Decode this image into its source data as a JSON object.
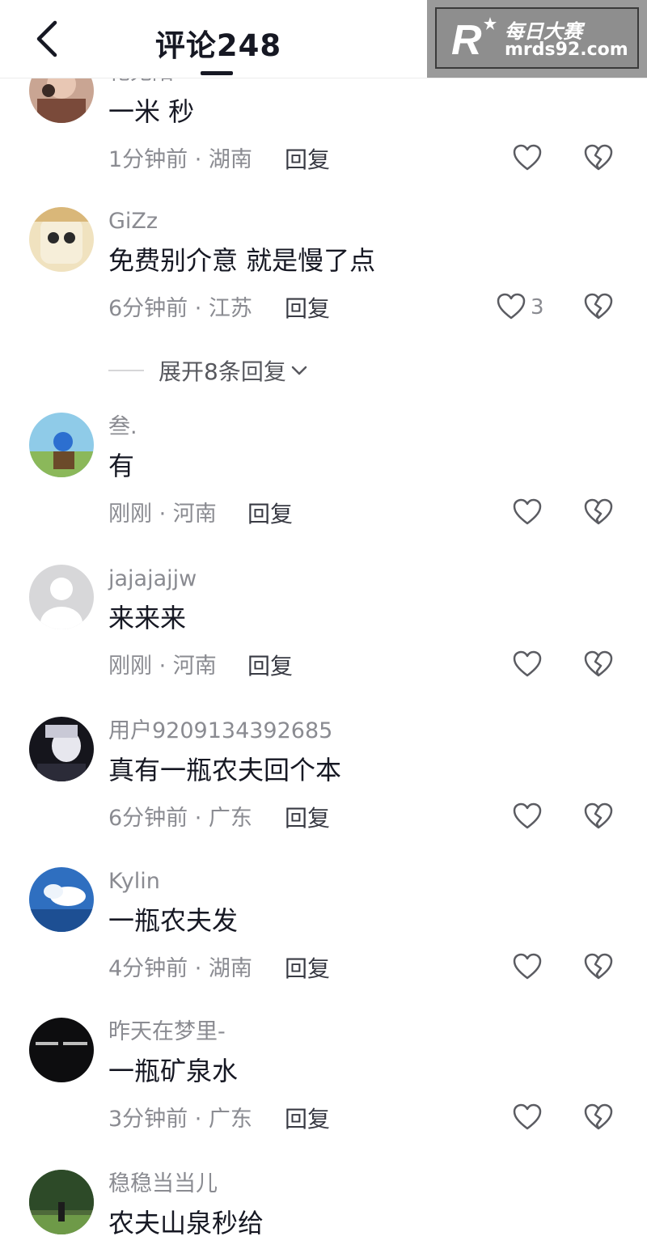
{
  "header": {
    "title": "评论248"
  },
  "watermark": {
    "brand_text": "每日大赛",
    "domain_text": "mrds92.com",
    "logo_letter": "R"
  },
  "comments": [
    {
      "username": "花无陌",
      "text": "一米 秒",
      "meta": "1分钟前 · 湖南",
      "reply_label": "回复",
      "like_count": ""
    },
    {
      "username": "GiZz",
      "text": "免费别介意 就是慢了点",
      "meta": "6分钟前 · 江苏",
      "reply_label": "回复",
      "like_count": "3",
      "expand_label": "展开8条回复"
    },
    {
      "username": "叁.",
      "text": "有",
      "meta": "刚刚 · 河南",
      "reply_label": "回复",
      "like_count": ""
    },
    {
      "username": "jajajajjw",
      "text": "来来来",
      "meta": "刚刚 · 河南",
      "reply_label": "回复",
      "like_count": ""
    },
    {
      "username": "用户9209134392685",
      "text": "真有一瓶农夫回个本",
      "meta": "6分钟前 · 广东",
      "reply_label": "回复",
      "like_count": ""
    },
    {
      "username": "Kylin",
      "text": "一瓶农夫发",
      "meta": "4分钟前 · 湖南",
      "reply_label": "回复",
      "like_count": ""
    },
    {
      "username": "昨天在梦里-",
      "text": "一瓶矿泉水",
      "meta": "3分钟前 · 广东",
      "reply_label": "回复",
      "like_count": ""
    },
    {
      "username": "稳稳当当儿",
      "text": "农夫山泉秒给",
      "meta": "",
      "reply_label": "",
      "like_count": ""
    }
  ],
  "icons": {
    "back": "chevron-left-icon",
    "like": "heart-outline-icon",
    "dislike": "broken-heart-icon",
    "expand": "chevron-down-icon"
  },
  "colors": {
    "text_primary": "#161823",
    "text_secondary": "#8a8b91",
    "background": "#ffffff"
  }
}
